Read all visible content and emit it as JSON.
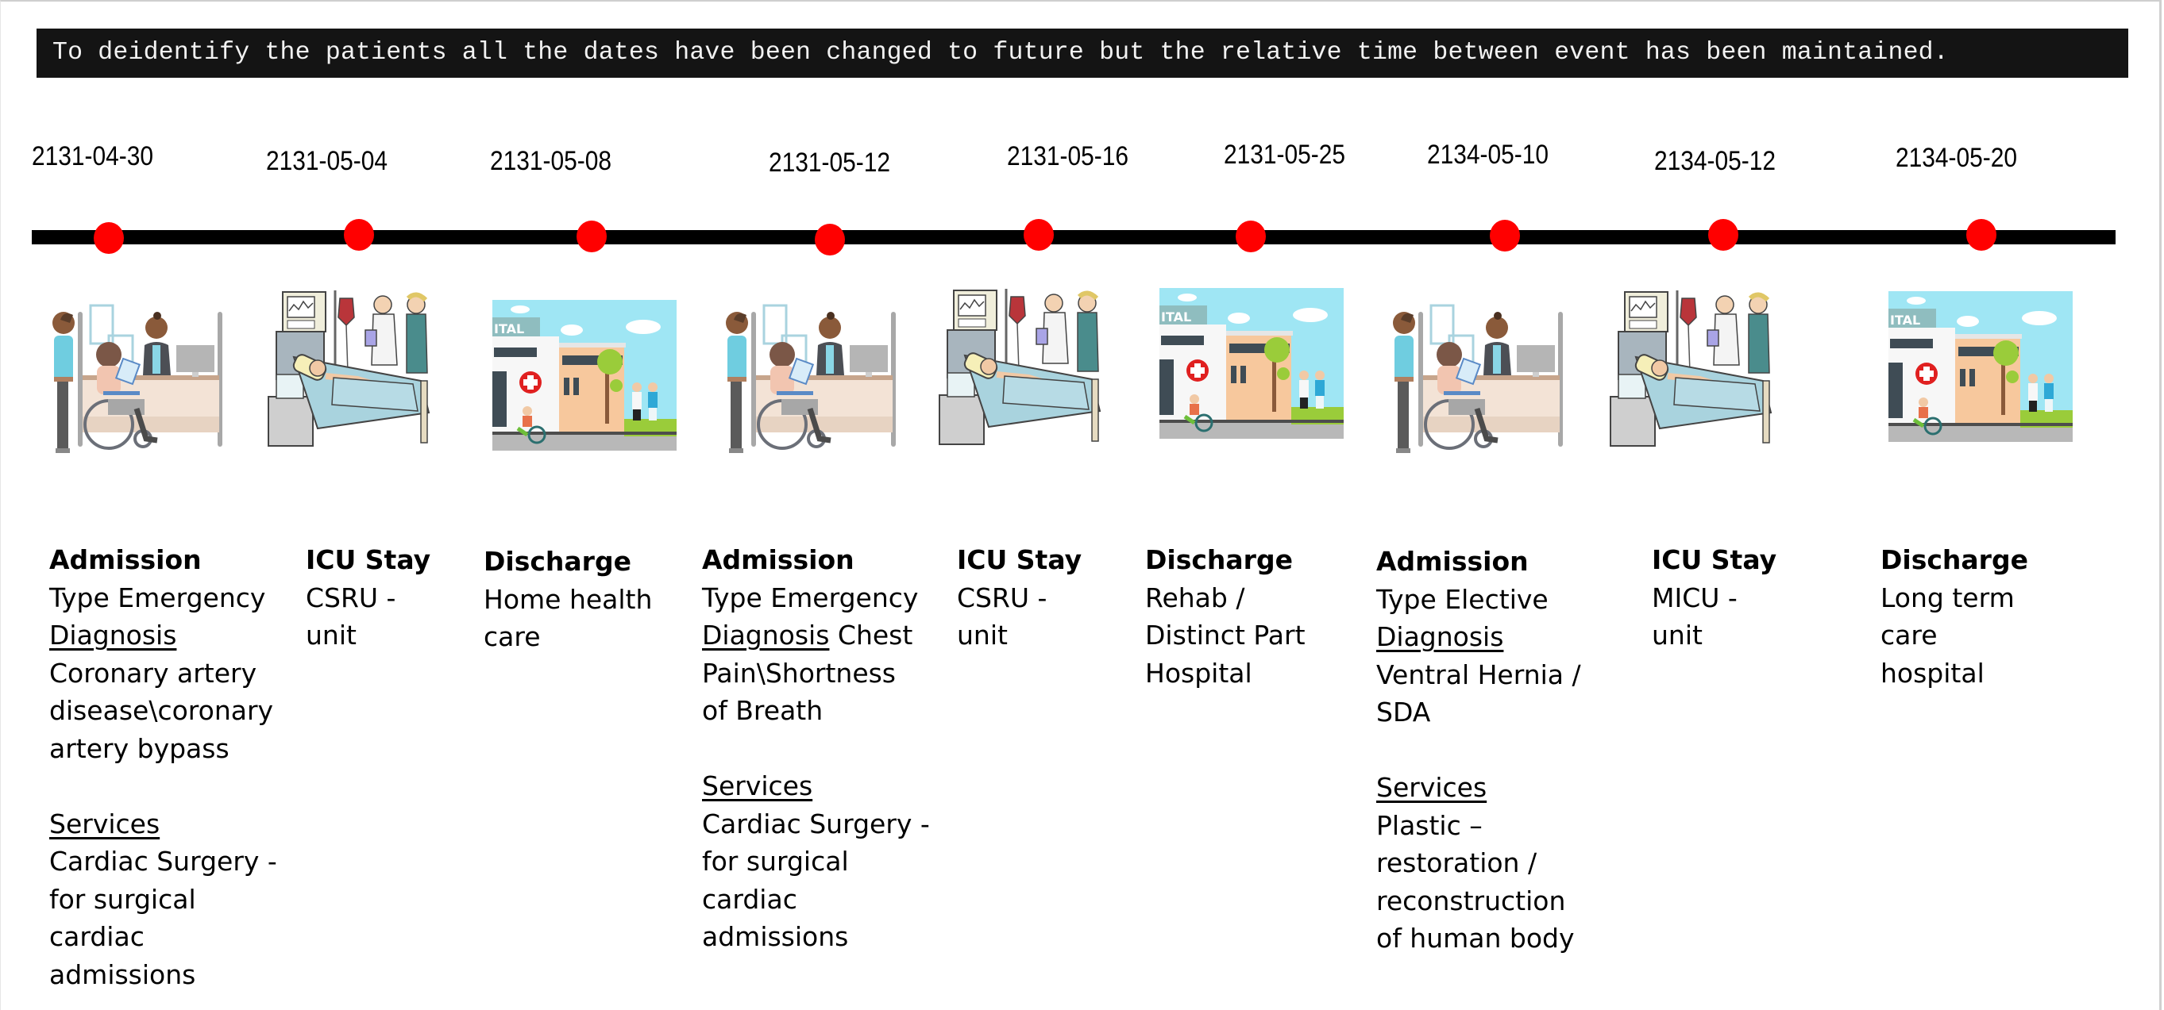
{
  "banner": {
    "text": "To deidentify the patients all the dates have been changed to future but the relative time between event has been maintained."
  },
  "colors": {
    "banner_bg": "#141414",
    "banner_text": "#f2f2f2",
    "timeline": "#000000",
    "marker": "#ff0000"
  },
  "events": [
    {
      "date": "2131-04-30",
      "type": "admission",
      "illustration": "reception-desk-wheelchair-illustration",
      "title": "Admission",
      "lines": [
        "Type Emergency"
      ],
      "diagnosis_label": "Diagnosis",
      "diagnosis_inline": "",
      "diagnosis_lines": [
        "Coronary artery",
        "disease\\coronary",
        "artery bypass"
      ],
      "services_label": "Services",
      "services_lines": [
        "Cardiac Surgery -",
        "for surgical",
        "cardiac",
        "admissions"
      ]
    },
    {
      "date": "2131-05-04",
      "type": "icu",
      "illustration": "icu-bed-patient-illustration",
      "title": "ICU Stay",
      "lines": [
        "CSRU -",
        "unit"
      ]
    },
    {
      "date": "2131-05-08",
      "type": "discharge",
      "illustration": "hospital-building-illustration",
      "title": "Discharge",
      "lines": [
        "Home health",
        "care"
      ]
    },
    {
      "date": "2131-05-12",
      "type": "admission",
      "illustration": "reception-desk-wheelchair-illustration",
      "title": "Admission",
      "lines": [
        "Type Emergency"
      ],
      "diagnosis_label": "Diagnosis",
      "diagnosis_inline": " Chest",
      "diagnosis_lines": [
        "Pain\\Shortness",
        "of Breath"
      ],
      "services_label": "Services",
      "services_lines": [
        "Cardiac Surgery -",
        "for surgical",
        "cardiac",
        "admissions"
      ]
    },
    {
      "date": "2131-05-16",
      "type": "icu",
      "illustration": "icu-bed-patient-illustration",
      "title": "ICU Stay",
      "lines": [
        "CSRU -",
        "unit"
      ]
    },
    {
      "date": "2131-05-25",
      "type": "discharge",
      "illustration": "hospital-building-illustration",
      "title": "Discharge",
      "lines": [
        "Rehab /",
        "Distinct Part",
        "Hospital"
      ]
    },
    {
      "date": "2134-05-10",
      "type": "admission",
      "illustration": "reception-desk-wheelchair-illustration",
      "title": "Admission",
      "lines": [
        "Type Elective"
      ],
      "diagnosis_label": "Diagnosis",
      "diagnosis_inline": "",
      "diagnosis_lines": [
        "Ventral Hernia /",
        "SDA"
      ],
      "services_label": "Services",
      "services_lines": [
        "Plastic –",
        "restoration /",
        "reconstruction",
        "of human body"
      ]
    },
    {
      "date": "2134-05-12",
      "type": "icu",
      "illustration": "icu-bed-patient-illustration",
      "title": "ICU Stay",
      "lines": [
        "MICU -",
        "unit"
      ]
    },
    {
      "date": "2134-05-20",
      "type": "discharge",
      "illustration": "hospital-building-illustration",
      "title": "Discharge",
      "lines": [
        "Long term",
        "care",
        "hospital"
      ]
    }
  ]
}
